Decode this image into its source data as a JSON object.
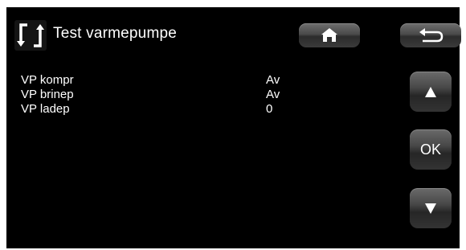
{
  "header": {
    "title": "Test varmepumpe",
    "title_icon": "arrows-refresh-icon",
    "home_icon": "home-icon",
    "back_icon": "back-arrow-icon"
  },
  "rows": [
    {
      "label": "VP kompr",
      "value": "Av"
    },
    {
      "label": "VP brinep",
      "value": "Av"
    },
    {
      "label": "VP ladep",
      "value": "0"
    }
  ],
  "nav": {
    "up_icon": "triangle-up-icon",
    "ok_label": "OK",
    "down_icon": "triangle-down-icon"
  },
  "colors": {
    "background": "#000000",
    "text": "#ffffff",
    "button": "#4a4a4a"
  }
}
